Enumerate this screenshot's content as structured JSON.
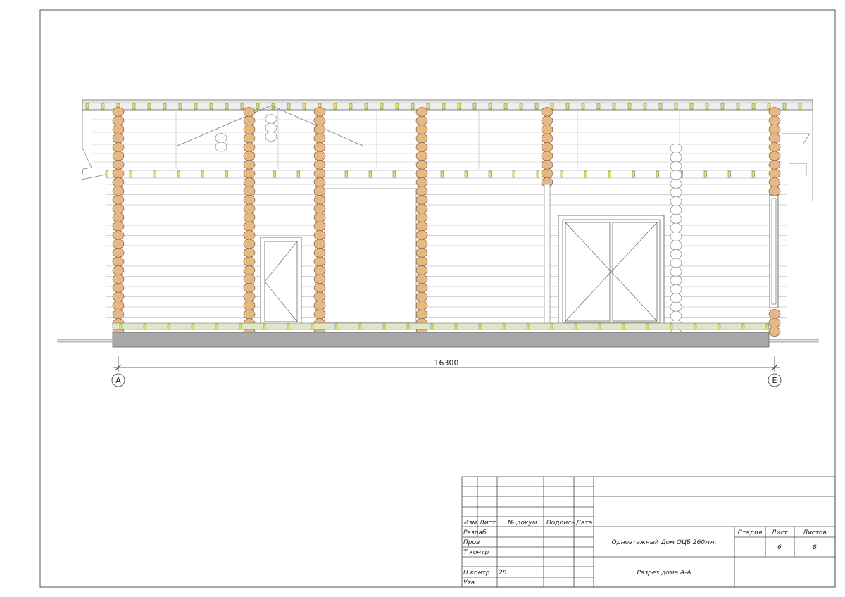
{
  "drawing": {
    "dimension": "16300",
    "axis_left": "А",
    "axis_right": "Е"
  },
  "title_block": {
    "headers": {
      "izm": "Изм",
      "list": "Лист",
      "doc_no": "№ докум",
      "sign": "Подпись",
      "date": "Дата"
    },
    "roles": {
      "razrab": "Разраб",
      "prov": "Пров",
      "tkontr": "Т.контр",
      "nkontr": "Н.контр",
      "utv": "Утв"
    },
    "nkontr_value": "28",
    "project_name": "Одноэтажный Дом ОЦБ 260мм.",
    "sheet_title": "Разрез дома А-А",
    "stage_label": "Стадия",
    "sheet_label": "Лист",
    "sheets_label": "Листов",
    "sheet_value": "6",
    "sheets_value": "8"
  }
}
